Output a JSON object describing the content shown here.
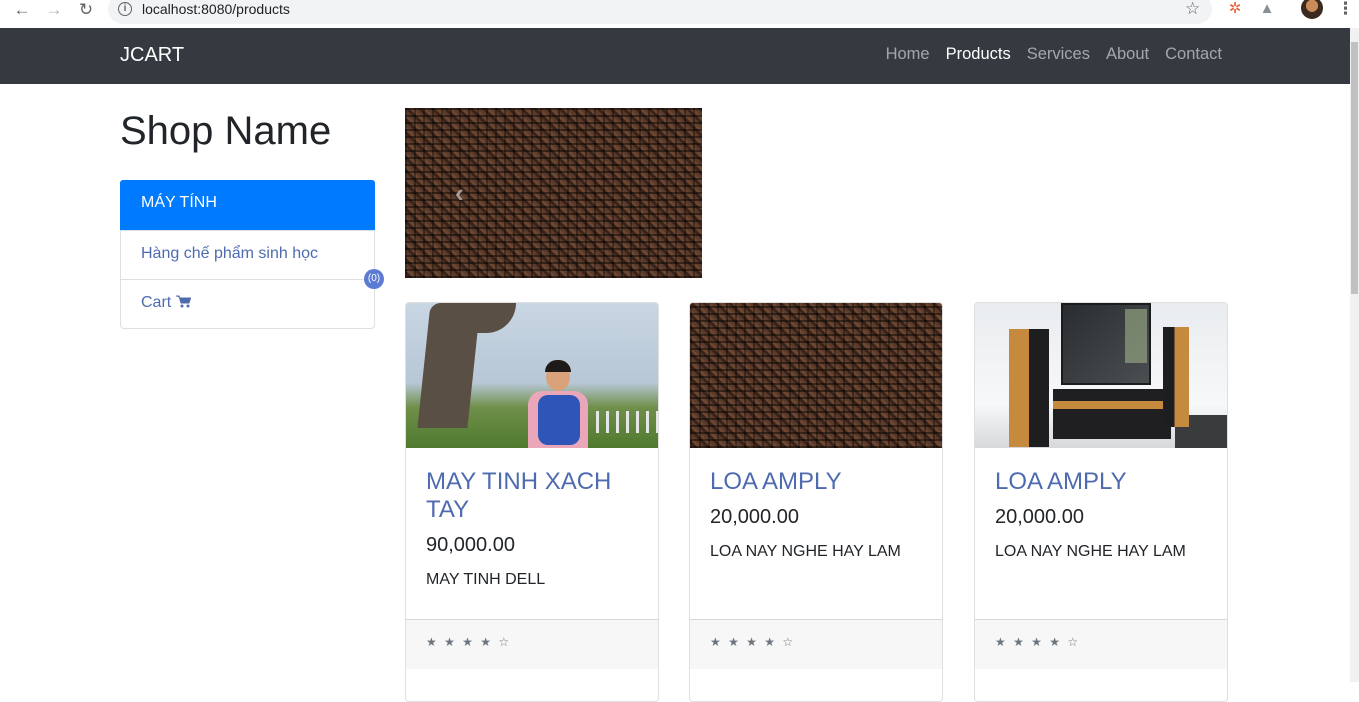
{
  "browser": {
    "url": "localhost:8080/products",
    "back_icon": "arrow-left",
    "forward_icon": "arrow-right",
    "reload_icon": "reload",
    "info_icon": "i",
    "bookmark_icon": "star"
  },
  "navbar": {
    "brand": "JCART",
    "links": [
      {
        "label": "Home",
        "active": false
      },
      {
        "label": "Products",
        "active": true
      },
      {
        "label": "Services",
        "active": false
      },
      {
        "label": "About",
        "active": false
      },
      {
        "label": "Contact",
        "active": false
      }
    ]
  },
  "sidebar": {
    "shop_title": "Shop Name",
    "items": [
      {
        "label": "MÁY TÍNH",
        "active": true
      },
      {
        "label": "Hàng chế phẩm sinh học",
        "active": false
      },
      {
        "label": "Cart",
        "icon": "cart-icon",
        "active": false
      }
    ],
    "cart_count": "(0)"
  },
  "carousel": {
    "prev_symbol": "‹"
  },
  "products": [
    {
      "title": "MAY TINH XACH TAY",
      "price": "90,000.00",
      "description": "MAY TINH DELL",
      "rating": "★ ★ ★ ★ ☆"
    },
    {
      "title": "LOA AMPLY",
      "price": "20,000.00",
      "description": "LOA NAY NGHE HAY LAM",
      "rating": "★ ★ ★ ★ ☆"
    },
    {
      "title": "LOA AMPLY",
      "price": "20,000.00",
      "description": "LOA NAY NGHE HAY LAM",
      "rating": "★ ★ ★ ★ ☆"
    }
  ],
  "colors": {
    "navbar_bg": "#343a40",
    "primary": "#007bff",
    "link": "#4f6bb0"
  }
}
